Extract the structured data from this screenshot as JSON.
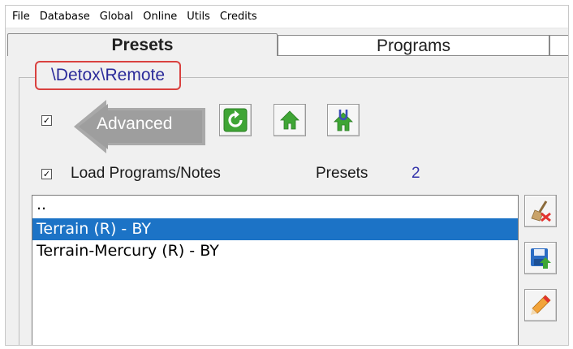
{
  "menu": [
    "File",
    "Database",
    "Global",
    "Online",
    "Utils",
    "Credits"
  ],
  "tabs": {
    "presets": "Presets",
    "programs": "Programs"
  },
  "path_label": "\\Detox\\Remote",
  "advanced": {
    "label": "Advanced",
    "checked": true,
    "check_glyph": "✓"
  },
  "toolbar_icons": [
    "refresh-icon",
    "home-icon",
    "home-upload-icon"
  ],
  "load_programs": {
    "label": "Load Programs/Notes",
    "checked": true,
    "check_glyph": "✓"
  },
  "presets_count": {
    "label": "Presets",
    "value": "2"
  },
  "list": {
    "items": [
      "..",
      "Terrain (R) - BY",
      "Terrain-Mercury (R) - BY"
    ],
    "selected_index": 1
  },
  "side_icons": [
    "delete-brush-icon",
    "save-icon",
    "edit-pencil-icon"
  ],
  "colors": {
    "accent_blue": "#1c73c6",
    "path_border": "#d9413f",
    "path_text": "#2b2b9a",
    "icon_green": "#3fa535"
  }
}
